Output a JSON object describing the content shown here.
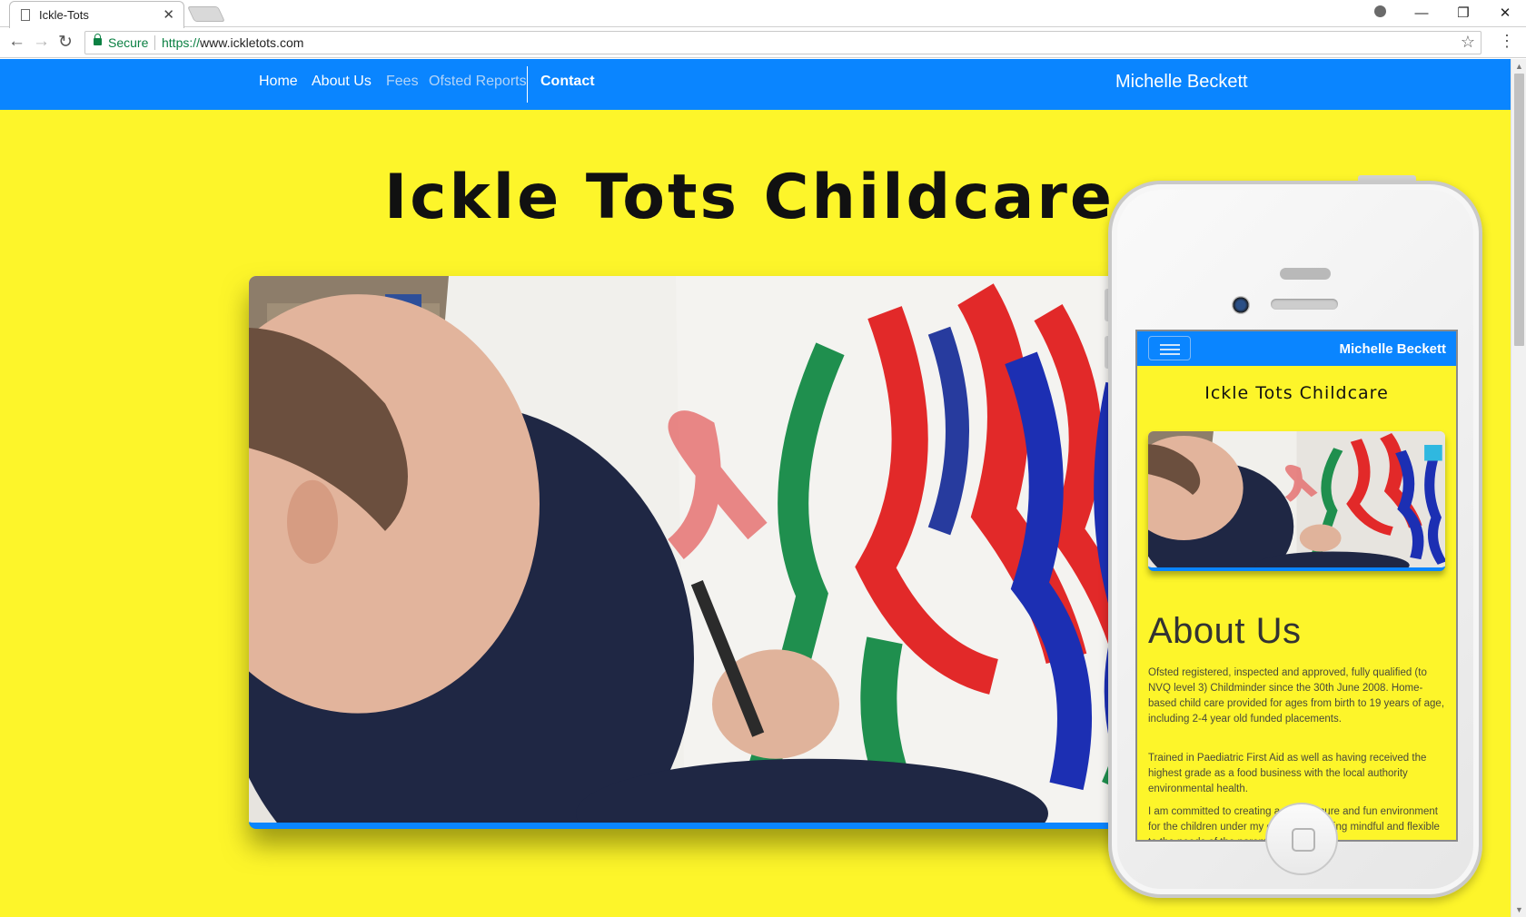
{
  "browser": {
    "tab_title": "Ickle-Tots",
    "tab_close": "✕",
    "secure_label": "Secure",
    "url_scheme": "https://",
    "url_host": "www.ickletots.com",
    "back": "←",
    "forward": "→",
    "reload": "↻",
    "bookmark_star": "☆",
    "menu": "⋮",
    "minimize": "—",
    "restore": "❐",
    "close": "✕"
  },
  "site": {
    "nav": {
      "items": [
        {
          "label": "Home"
        },
        {
          "label": "About Us"
        },
        {
          "label": "Fees"
        },
        {
          "label": "Ofsted Reports"
        },
        {
          "label": "Contact"
        }
      ],
      "brand": "Michelle Beckett"
    },
    "hero_title": "Ickle Tots Childcare"
  },
  "mobile": {
    "brand": "Michelle Beckett",
    "title": "Ickle Tots Childcare",
    "about_heading": "About Us",
    "paragraphs": [
      "Ofsted registered, inspected and approved, fully qualified (to NVQ level 3) Childminder since the 30th June 2008. Home-based child care provided for ages from birth to 19 years of age, including 2-4 year old funded placements.",
      "Trained in Paediatric First Aid as well as having received the highest grade as a food business with the local authority environmental health.",
      "I am committed to creating a safe, secure and fun environment for the children under my care; whilst being mindful and flexible to the needs of the parents."
    ]
  },
  "colors": {
    "page_background": "#fdf52a",
    "nav_blue": "#0a85ff",
    "nav_muted_text": "#b3d4f7",
    "secure_green": "#0b8043"
  }
}
